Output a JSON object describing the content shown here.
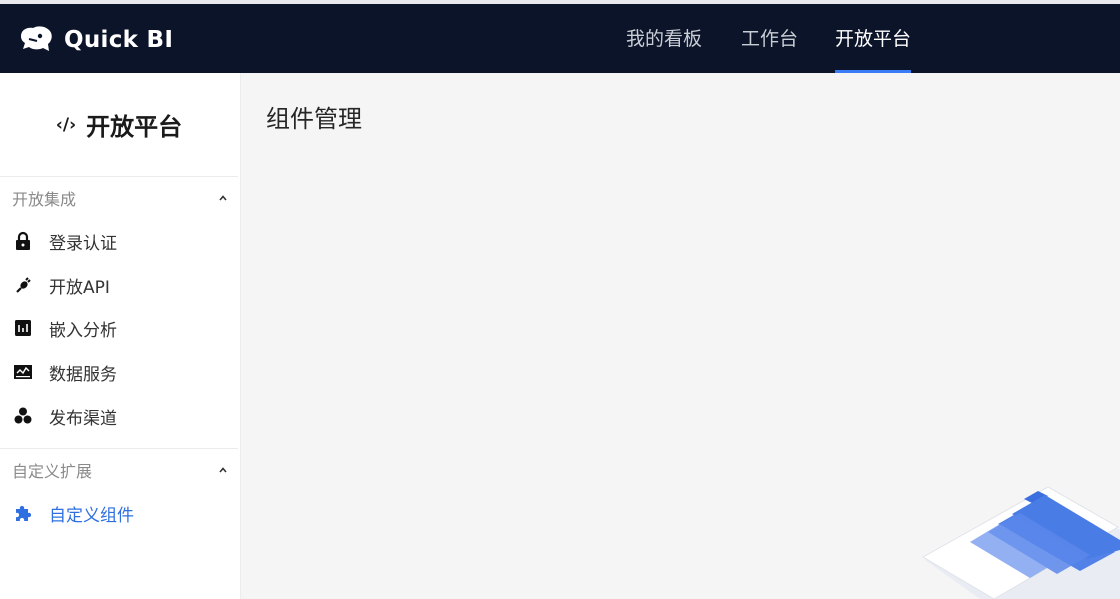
{
  "header": {
    "logo_text": "Quick BI",
    "nav": [
      {
        "label": "我的看板",
        "active": false
      },
      {
        "label": "工作台",
        "active": false
      },
      {
        "label": "开放平台",
        "active": true
      }
    ]
  },
  "sidebar": {
    "title": "开放平台",
    "title_icon": "code-icon",
    "groups": [
      {
        "label": "开放集成",
        "expanded": true,
        "items": [
          {
            "label": "登录认证",
            "icon": "lock-icon",
            "active": false
          },
          {
            "label": "开放API",
            "icon": "plug-icon",
            "active": false
          },
          {
            "label": "嵌入分析",
            "icon": "embed-chart-icon",
            "active": false
          },
          {
            "label": "数据服务",
            "icon": "data-service-icon",
            "active": false
          },
          {
            "label": "发布渠道",
            "icon": "hexagon-cluster-icon",
            "active": false
          }
        ]
      },
      {
        "label": "自定义扩展",
        "expanded": true,
        "items": [
          {
            "label": "自定义组件",
            "icon": "puzzle-icon",
            "active": true
          }
        ]
      }
    ]
  },
  "main": {
    "title": "组件管理"
  },
  "colors": {
    "topbar_bg": "#0b1428",
    "accent": "#3a7cf5",
    "active_item": "#2f6fe0"
  }
}
